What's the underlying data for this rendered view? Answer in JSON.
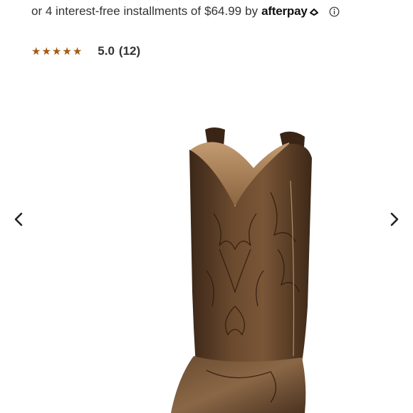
{
  "installments": {
    "prefix": "or 4 interest-free installments of",
    "amount": "$64.99",
    "by": "by",
    "provider": "afterpay"
  },
  "rating": {
    "stars": 5,
    "value": "5.0",
    "count": "(12)"
  },
  "gallery": {
    "prev_icon": "chevron-left-icon",
    "next_icon": "chevron-right-icon"
  },
  "colors": {
    "star": "#a35a12",
    "boot_leather": "#5a3a22",
    "boot_dark": "#2e1e14",
    "text": "#333333"
  }
}
